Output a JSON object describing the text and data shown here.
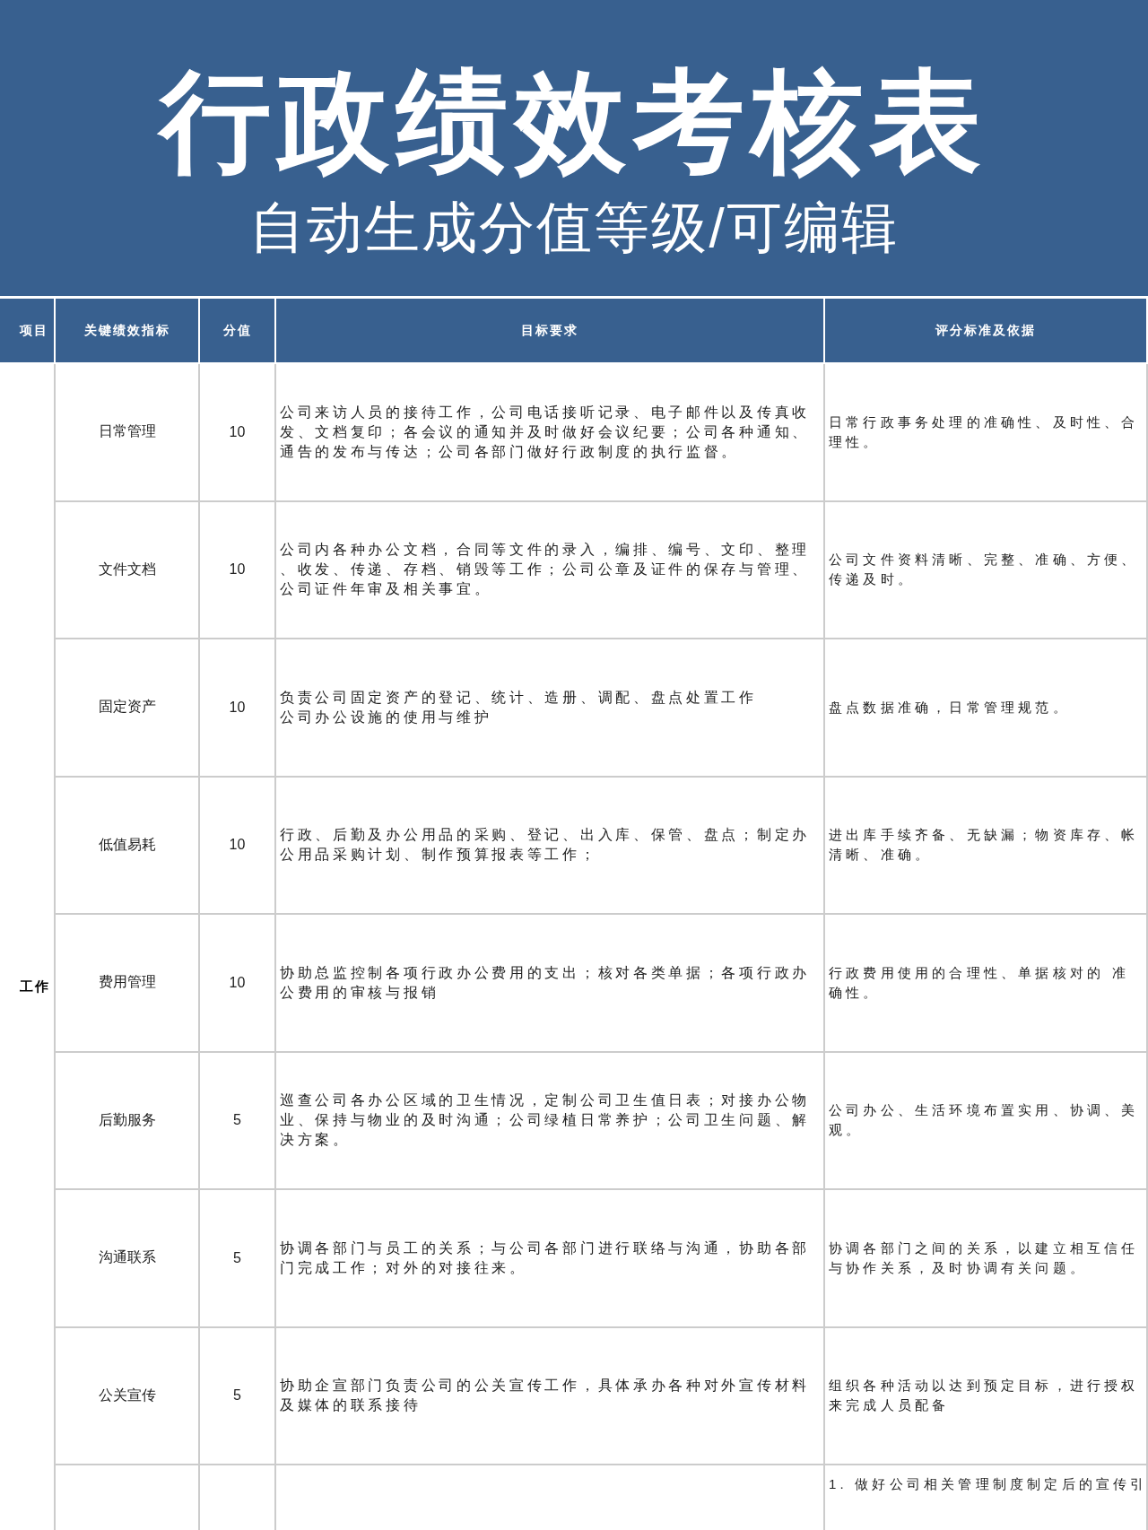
{
  "banner": {
    "title": "行政绩效考核表",
    "subtitle": "自动生成分值等级/可编辑"
  },
  "table": {
    "columns": [
      "项目",
      "关键绩效指标",
      "分值",
      "目标要求",
      "评分标准及依据"
    ],
    "category": "工作",
    "rows": [
      {
        "indicator": "日常管理",
        "score": "10",
        "target": [
          "公司来访人员的接待工作，公司电话接听记录、电子邮件以及传真收",
          "发、文档复印；各会议的通知并及时做好会议纪要；公司各种通知、",
          "通告的发布与传达；公司各部门做好行政制度的执行监督。"
        ],
        "criteria": [
          "日常行政事务处理的准确性、及时性、合",
          "理性。"
        ]
      },
      {
        "indicator": "文件文档",
        "score": "10",
        "target": [
          "公司内各种办公文档，合同等文件的录入，编排、编号、文印、整理",
          "、收发、传递、存档、销毁等工作；公司公章及证件的保存与管理、",
          "公司证件年审及相关事宜。"
        ],
        "criteria": [
          "公司文件资料清晰、完整、准确、方便、",
          "传递及时。"
        ]
      },
      {
        "indicator": "固定资产",
        "score": "10",
        "target": [
          "负责公司固定资产的登记、统计、造册、调配、盘点处置工作",
          "公司办公设施的使用与维护"
        ],
        "criteria": [
          "盘点数据准确，日常管理规范。"
        ]
      },
      {
        "indicator": "低值易耗",
        "score": "10",
        "target": [
          "行政、后勤及办公用品的采购、登记、出入库、保管、盘点；制定办",
          "公用品采购计划、制作预算报表等工作；"
        ],
        "criteria": [
          "进出库手续齐备、无缺漏；物资库存、帐",
          "清晰、准确。"
        ]
      },
      {
        "indicator": "费用管理",
        "score": "10",
        "target": [
          "协助总监控制各项行政办公费用的支出；核对各类单据；各项行政办",
          "公费用的审核与报销"
        ],
        "criteria": [
          "行政费用使用的合理性、单据核对的 准",
          "确性。"
        ]
      },
      {
        "indicator": "后勤服务",
        "score": "5",
        "target": [
          "巡查公司各办公区域的卫生情况，定制公司卫生值日表；对接办公物",
          "业、保持与物业的及时沟通；公司绿植日常养护；公司卫生问题、解",
          "决方案。"
        ],
        "criteria": [
          "公司办公、生活环境布置实用、协调、美",
          "观。"
        ]
      },
      {
        "indicator": "沟通联系",
        "score": "5",
        "target": [
          "协调各部门与员工的关系；与公司各部门进行联络与沟通，协助各部",
          "门完成工作；对外的对接往来。"
        ],
        "criteria": [
          "协调各部门之间的关系，以建立相互信任",
          "与协作关系，及时协调有关问题。"
        ]
      },
      {
        "indicator": "公关宣传",
        "score": "5",
        "target": [
          "协助企宣部门负责公司的公关宣传工作，具体承办各种对外宣传材料",
          "及媒体的联系接待"
        ],
        "criteria": [
          "组织各种活动以达到预定目标，进行授权",
          "来完成人员配备"
        ]
      },
      {
        "criteria": [
          "1. 做好公司相关管理制度制定后的宣传引"
        ]
      }
    ]
  }
}
